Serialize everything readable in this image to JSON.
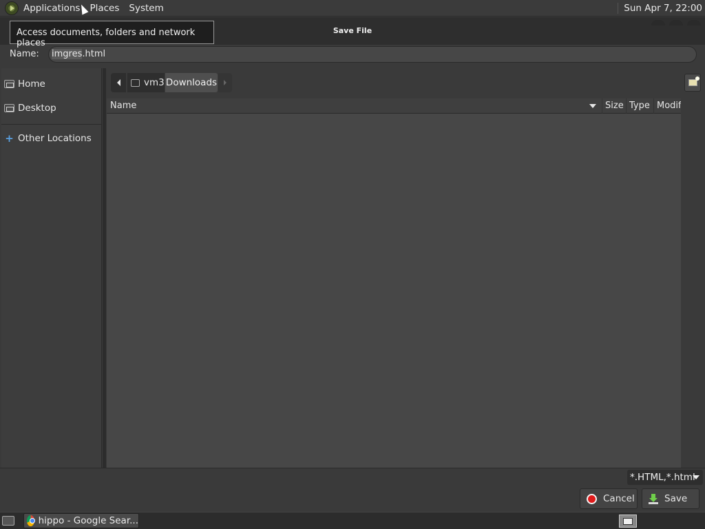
{
  "panel": {
    "applications": "Applications",
    "places": "Places",
    "system": "System",
    "clock": "Sun Apr  7, 22:00"
  },
  "tooltip": {
    "text": "Access documents, folders and network places"
  },
  "dialog": {
    "title": "Save File",
    "name_label": "Name:",
    "filename_selected": "imgres",
    "filename_rest": ".html"
  },
  "sidebar": {
    "items": [
      {
        "label": "Home",
        "icon": "home-folder-icon"
      },
      {
        "label": "Desktop",
        "icon": "desktop-folder-icon"
      },
      {
        "label": "Other Locations",
        "icon": "plus-icon"
      }
    ]
  },
  "pathbar": {
    "home_segment": "vm3",
    "current_segment": "Downloads"
  },
  "filelist": {
    "columns": [
      "Name",
      "Size",
      "Type",
      "Modif"
    ],
    "rows": []
  },
  "footer": {
    "filter": "*.HTML,*.html",
    "cancel": "Cancel",
    "save": "Save"
  },
  "taskbar": {
    "window_title": "hippo - Google Sear..."
  },
  "colors": {
    "cancel_icon": "#e01b1b",
    "save_icon": "#6fcf4a",
    "other_locations_icon": "#5aa0e0"
  }
}
